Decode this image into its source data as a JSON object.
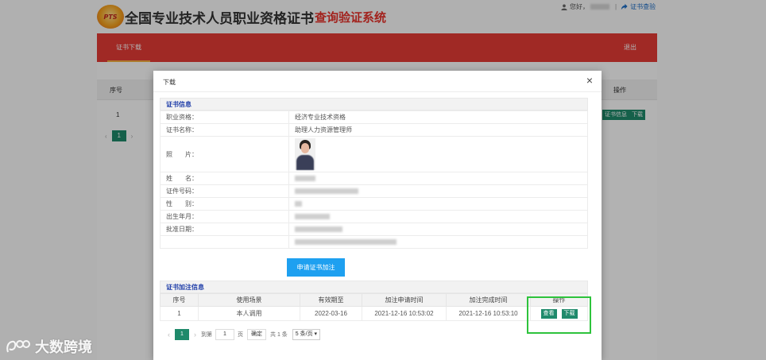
{
  "header": {
    "logo_badge": "PTS",
    "title": "全国专业技术人员职业资格证书",
    "subtitle": "查询验证系统",
    "greeting": "您好，",
    "separator": "|",
    "verify_link": "证书查验"
  },
  "nav": {
    "active_tab": "证书下载",
    "logout": "退出",
    "colors": {
      "bar": "#e63c36",
      "underline": "#f7b043"
    }
  },
  "background": {
    "col_index": "序号",
    "col_ops": "操作",
    "row_index": "1",
    "btn_info": "证书信息",
    "btn_download": "下载",
    "page": "1"
  },
  "modal": {
    "title": "下载",
    "close": "×",
    "cert_section_title": "证书信息",
    "rows": [
      {
        "label": "职业资格：",
        "value": "经济专业技术资格"
      },
      {
        "label": "证书名称：",
        "value": "助理人力资源管理师"
      },
      {
        "label": "照　　片：",
        "value": ""
      },
      {
        "label": "姓　　名：",
        "value": ""
      },
      {
        "label": "证件号码：",
        "value": ""
      },
      {
        "label": "性　　别：",
        "value": ""
      },
      {
        "label": "出生年月：",
        "value": ""
      },
      {
        "label": "批准日期：",
        "value": ""
      },
      {
        "label": "",
        "value": ""
      }
    ],
    "apply_button": "申请证书加注",
    "annotation_section_title": "证书加注信息",
    "annotation_table": {
      "headers": [
        "序号",
        "使用场景",
        "有效期至",
        "加注申请时间",
        "加注完成时间",
        "操作"
      ],
      "rows": [
        {
          "index": "1",
          "scene": "本人调用",
          "valid_until": "2022-03-16",
          "apply_time": "2021-12-16 10:53:02",
          "done_time": "2021-12-16 10:53:10",
          "view": "查看",
          "download": "下载"
        }
      ]
    },
    "pager": {
      "prev": "‹",
      "current": "1",
      "next": "›",
      "goto_label": "到第",
      "goto_value": "1",
      "page_unit": "页",
      "confirm": "确定",
      "total": "共 1 条",
      "page_size": "5 条/页"
    }
  },
  "watermark": {
    "text": "大数跨境"
  }
}
